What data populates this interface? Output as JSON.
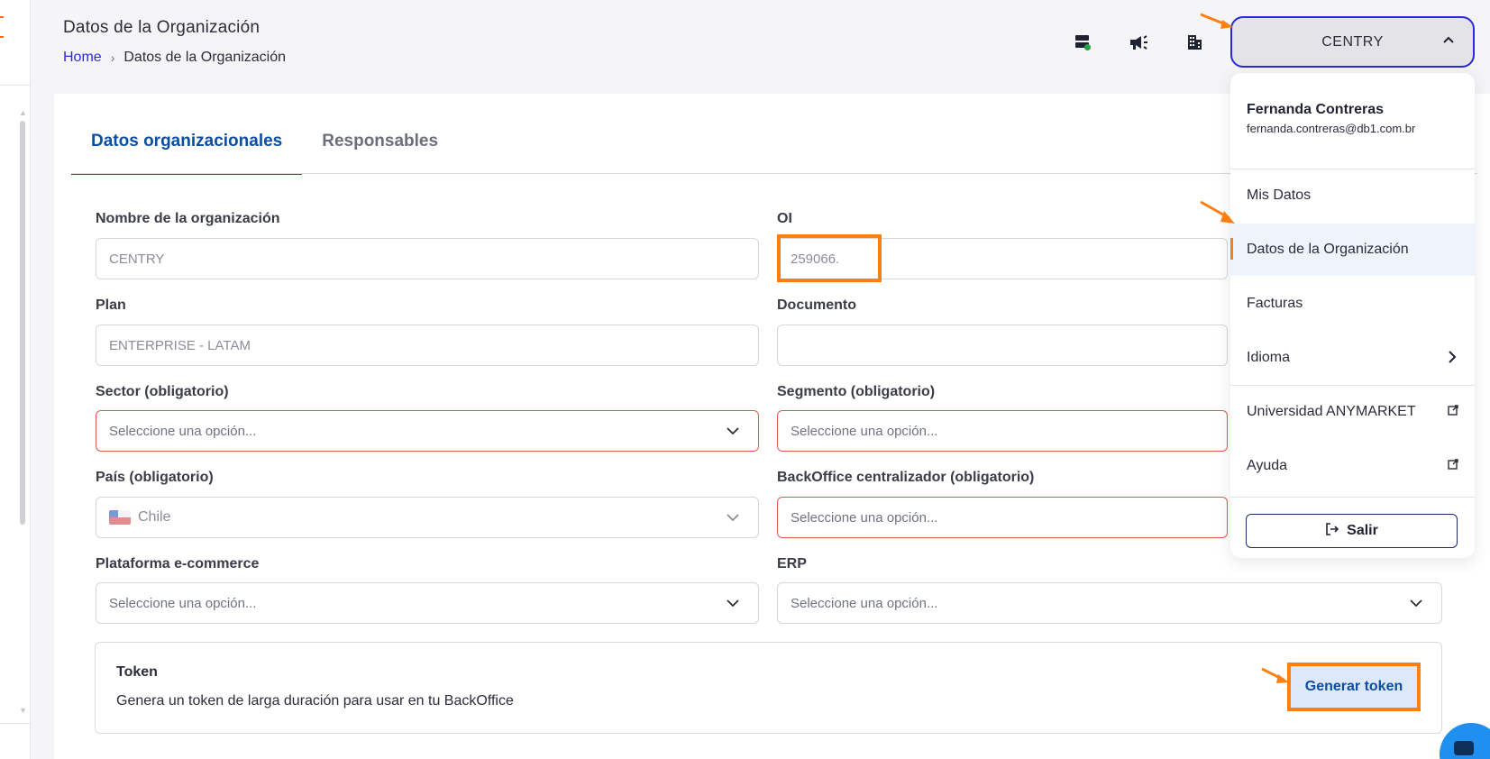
{
  "header": {
    "page_title": "Datos de la Organización",
    "breadcrumb": {
      "home": "Home",
      "separator": "›",
      "current": "Datos de la Organización"
    },
    "org_switcher": "CENTRY"
  },
  "tabs": [
    {
      "label": "Datos organizacionales",
      "active": true
    },
    {
      "label": "Responsables",
      "active": false
    }
  ],
  "form": {
    "org_name": {
      "label": "Nombre de la organización",
      "value": "CENTRY"
    },
    "oi": {
      "label": "OI",
      "value": "259066."
    },
    "plan": {
      "label": "Plan",
      "value": "ENTERPRISE - LATAM"
    },
    "documento": {
      "label": "Documento",
      "value": ""
    },
    "sector": {
      "label": "Sector (obligatorio)",
      "placeholder": "Seleccione una opción..."
    },
    "segmento": {
      "label": "Segmento (obligatorio)",
      "placeholder": "Seleccione una opción..."
    },
    "pais": {
      "label": "País (obligatorio)",
      "value": "Chile"
    },
    "backoffice": {
      "label": "BackOffice centralizador (obligatorio)",
      "placeholder": "Seleccione una opción..."
    },
    "plataforma": {
      "label": "Plataforma e-commerce",
      "placeholder": "Seleccione una opción..."
    },
    "erp": {
      "label": "ERP",
      "placeholder": "Seleccione una opción..."
    }
  },
  "token": {
    "title": "Token",
    "description": "Genera un token de larga duración para usar en tu BackOffice",
    "button": "Generar token"
  },
  "user_menu": {
    "name": "Fernanda Contreras",
    "email": "fernanda.contreras@db1.com.br",
    "items": [
      {
        "label": "Mis Datos"
      },
      {
        "label": "Datos de la Organización",
        "active": true
      },
      {
        "label": "Facturas"
      },
      {
        "label": "Idioma",
        "icon": "chevron-right-icon"
      },
      {
        "label": "Universidad ANYMARKET",
        "icon": "external-link-icon"
      },
      {
        "label": "Ayuda",
        "icon": "external-link-icon"
      }
    ],
    "logout": "Salir"
  },
  "colors": {
    "accent_blue": "#0b4ea2",
    "highlight_orange": "#ff7f11",
    "error_red": "#e2574c",
    "switch_border": "#2a2ad8"
  }
}
